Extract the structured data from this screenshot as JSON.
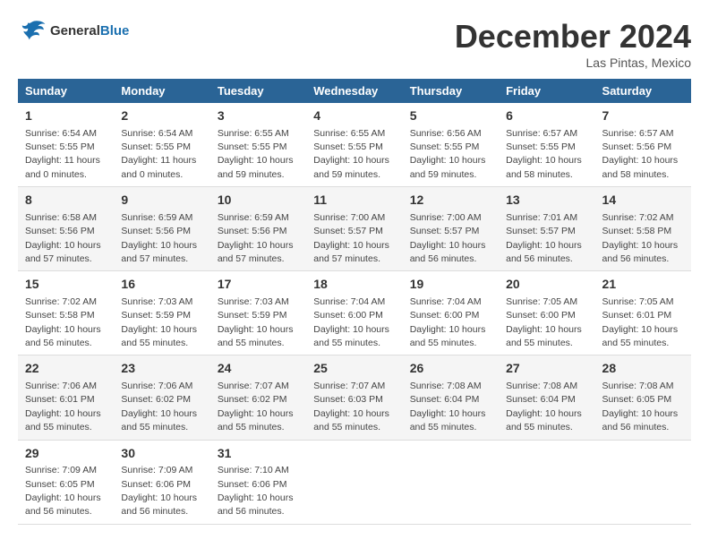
{
  "logo": {
    "line1": "General",
    "line2": "Blue"
  },
  "title": "December 2024",
  "location": "Las Pintas, Mexico",
  "days_of_week": [
    "Sunday",
    "Monday",
    "Tuesday",
    "Wednesday",
    "Thursday",
    "Friday",
    "Saturday"
  ],
  "weeks": [
    [
      {
        "day": "1",
        "sunrise": "6:54 AM",
        "sunset": "5:55 PM",
        "daylight": "11 hours and 0 minutes."
      },
      {
        "day": "2",
        "sunrise": "6:54 AM",
        "sunset": "5:55 PM",
        "daylight": "11 hours and 0 minutes."
      },
      {
        "day": "3",
        "sunrise": "6:55 AM",
        "sunset": "5:55 PM",
        "daylight": "10 hours and 59 minutes."
      },
      {
        "day": "4",
        "sunrise": "6:55 AM",
        "sunset": "5:55 PM",
        "daylight": "10 hours and 59 minutes."
      },
      {
        "day": "5",
        "sunrise": "6:56 AM",
        "sunset": "5:55 PM",
        "daylight": "10 hours and 59 minutes."
      },
      {
        "day": "6",
        "sunrise": "6:57 AM",
        "sunset": "5:55 PM",
        "daylight": "10 hours and 58 minutes."
      },
      {
        "day": "7",
        "sunrise": "6:57 AM",
        "sunset": "5:56 PM",
        "daylight": "10 hours and 58 minutes."
      }
    ],
    [
      {
        "day": "8",
        "sunrise": "6:58 AM",
        "sunset": "5:56 PM",
        "daylight": "10 hours and 57 minutes."
      },
      {
        "day": "9",
        "sunrise": "6:59 AM",
        "sunset": "5:56 PM",
        "daylight": "10 hours and 57 minutes."
      },
      {
        "day": "10",
        "sunrise": "6:59 AM",
        "sunset": "5:56 PM",
        "daylight": "10 hours and 57 minutes."
      },
      {
        "day": "11",
        "sunrise": "7:00 AM",
        "sunset": "5:57 PM",
        "daylight": "10 hours and 57 minutes."
      },
      {
        "day": "12",
        "sunrise": "7:00 AM",
        "sunset": "5:57 PM",
        "daylight": "10 hours and 56 minutes."
      },
      {
        "day": "13",
        "sunrise": "7:01 AM",
        "sunset": "5:57 PM",
        "daylight": "10 hours and 56 minutes."
      },
      {
        "day": "14",
        "sunrise": "7:02 AM",
        "sunset": "5:58 PM",
        "daylight": "10 hours and 56 minutes."
      }
    ],
    [
      {
        "day": "15",
        "sunrise": "7:02 AM",
        "sunset": "5:58 PM",
        "daylight": "10 hours and 56 minutes."
      },
      {
        "day": "16",
        "sunrise": "7:03 AM",
        "sunset": "5:59 PM",
        "daylight": "10 hours and 55 minutes."
      },
      {
        "day": "17",
        "sunrise": "7:03 AM",
        "sunset": "5:59 PM",
        "daylight": "10 hours and 55 minutes."
      },
      {
        "day": "18",
        "sunrise": "7:04 AM",
        "sunset": "6:00 PM",
        "daylight": "10 hours and 55 minutes."
      },
      {
        "day": "19",
        "sunrise": "7:04 AM",
        "sunset": "6:00 PM",
        "daylight": "10 hours and 55 minutes."
      },
      {
        "day": "20",
        "sunrise": "7:05 AM",
        "sunset": "6:00 PM",
        "daylight": "10 hours and 55 minutes."
      },
      {
        "day": "21",
        "sunrise": "7:05 AM",
        "sunset": "6:01 PM",
        "daylight": "10 hours and 55 minutes."
      }
    ],
    [
      {
        "day": "22",
        "sunrise": "7:06 AM",
        "sunset": "6:01 PM",
        "daylight": "10 hours and 55 minutes."
      },
      {
        "day": "23",
        "sunrise": "7:06 AM",
        "sunset": "6:02 PM",
        "daylight": "10 hours and 55 minutes."
      },
      {
        "day": "24",
        "sunrise": "7:07 AM",
        "sunset": "6:02 PM",
        "daylight": "10 hours and 55 minutes."
      },
      {
        "day": "25",
        "sunrise": "7:07 AM",
        "sunset": "6:03 PM",
        "daylight": "10 hours and 55 minutes."
      },
      {
        "day": "26",
        "sunrise": "7:08 AM",
        "sunset": "6:04 PM",
        "daylight": "10 hours and 55 minutes."
      },
      {
        "day": "27",
        "sunrise": "7:08 AM",
        "sunset": "6:04 PM",
        "daylight": "10 hours and 55 minutes."
      },
      {
        "day": "28",
        "sunrise": "7:08 AM",
        "sunset": "6:05 PM",
        "daylight": "10 hours and 56 minutes."
      }
    ],
    [
      {
        "day": "29",
        "sunrise": "7:09 AM",
        "sunset": "6:05 PM",
        "daylight": "10 hours and 56 minutes."
      },
      {
        "day": "30",
        "sunrise": "7:09 AM",
        "sunset": "6:06 PM",
        "daylight": "10 hours and 56 minutes."
      },
      {
        "day": "31",
        "sunrise": "7:10 AM",
        "sunset": "6:06 PM",
        "daylight": "10 hours and 56 minutes."
      },
      {
        "day": "",
        "sunrise": "",
        "sunset": "",
        "daylight": ""
      },
      {
        "day": "",
        "sunrise": "",
        "sunset": "",
        "daylight": ""
      },
      {
        "day": "",
        "sunrise": "",
        "sunset": "",
        "daylight": ""
      },
      {
        "day": "",
        "sunrise": "",
        "sunset": "",
        "daylight": ""
      }
    ]
  ]
}
